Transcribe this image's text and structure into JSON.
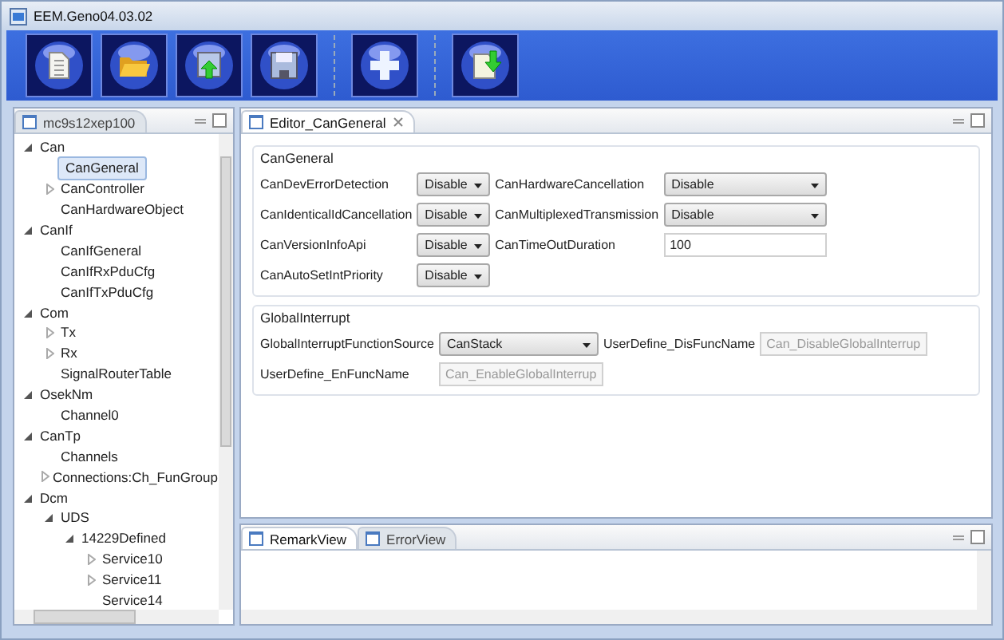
{
  "window": {
    "title": "EEM.Geno04.03.02"
  },
  "toolbar": [
    {
      "kind": "document"
    },
    {
      "kind": "folder"
    },
    {
      "kind": "upload"
    },
    {
      "kind": "save"
    },
    {
      "kind": "plus",
      "separator_before": true
    },
    {
      "kind": "import",
      "separator_before": true
    }
  ],
  "project_panel": {
    "title": "mc9s12xep100",
    "tree": [
      {
        "label": "Can",
        "expanded": true,
        "children": [
          {
            "label": "CanGeneral",
            "selected": true
          },
          {
            "label": "CanController",
            "expanded": false
          },
          {
            "label": "CanHardwareObject"
          }
        ]
      },
      {
        "label": "CanIf",
        "expanded": true,
        "children": [
          {
            "label": "CanIfGeneral"
          },
          {
            "label": "CanIfRxPduCfg"
          },
          {
            "label": "CanIfTxPduCfg"
          }
        ]
      },
      {
        "label": "Com",
        "expanded": true,
        "children": [
          {
            "label": "Tx",
            "expanded": false
          },
          {
            "label": "Rx",
            "expanded": false
          },
          {
            "label": "SignalRouterTable"
          }
        ]
      },
      {
        "label": "OsekNm",
        "expanded": true,
        "children": [
          {
            "label": "Channel0"
          }
        ]
      },
      {
        "label": "CanTp",
        "expanded": true,
        "children": [
          {
            "label": "Channels"
          },
          {
            "label": "Connections:Ch_FunGroup",
            "expanded": false
          }
        ]
      },
      {
        "label": "Dcm",
        "expanded": true,
        "children": [
          {
            "label": "UDS",
            "expanded": true,
            "children": [
              {
                "label": "14229Defined",
                "expanded": true,
                "children": [
                  {
                    "label": "Service10",
                    "expanded": false
                  },
                  {
                    "label": "Service11",
                    "expanded": false
                  },
                  {
                    "label": "Service14"
                  }
                ]
              }
            ]
          }
        ]
      }
    ]
  },
  "editor": {
    "tab": "Editor_CanGeneral",
    "groups": [
      {
        "title": "CanGeneral",
        "fields": [
          {
            "label": "CanDevErrorDetection",
            "kind": "select",
            "value": "Disable"
          },
          {
            "label": "CanHardwareCancellation",
            "kind": "select",
            "value": "Disable"
          },
          {
            "label": "CanIdenticalIdCancellation",
            "kind": "select",
            "value": "Disable"
          },
          {
            "label": "CanMultiplexedTransmission",
            "kind": "select",
            "value": "Disable"
          },
          {
            "label": "CanVersionInfoApi",
            "kind": "select",
            "value": "Disable"
          },
          {
            "label": "CanTimeOutDuration",
            "kind": "text",
            "value": "100",
            "disabled": false
          },
          {
            "label": "CanAutoSetIntPriority",
            "kind": "select",
            "value": "Disable"
          }
        ]
      },
      {
        "title": "GlobalInterrupt",
        "fields": [
          {
            "label": "GlobalInterruptFunctionSource",
            "kind": "select",
            "value": "CanStack"
          },
          {
            "label": "UserDefine_DisFuncName",
            "kind": "text",
            "value": "Can_DisableGlobalInterrup",
            "disabled": true
          },
          {
            "label": "UserDefine_EnFuncName",
            "kind": "text",
            "value": "Can_EnableGlobalInterrup",
            "disabled": true
          }
        ]
      }
    ]
  },
  "bottom_panel": {
    "tabs": [
      {
        "label": "RemarkView",
        "selected": true
      },
      {
        "label": "ErrorView",
        "selected": false
      }
    ]
  }
}
